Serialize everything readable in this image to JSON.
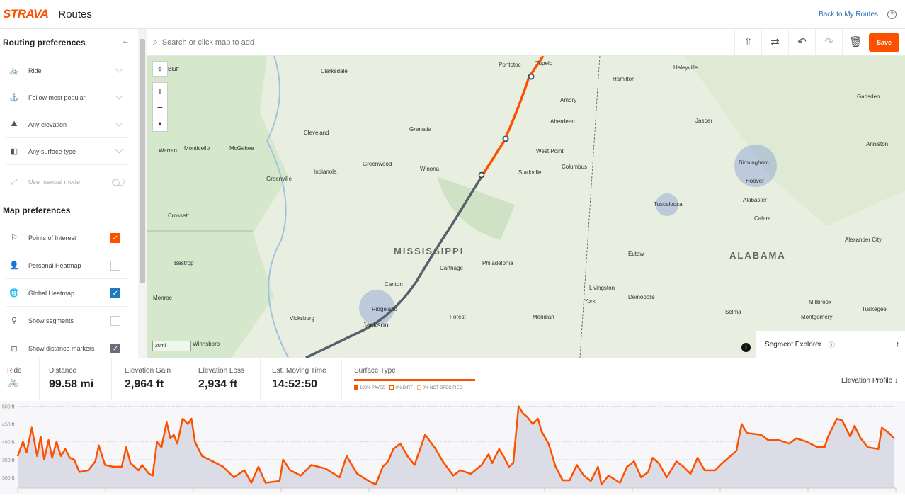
{
  "header": {
    "logo": "STRAVA",
    "title": "Routes",
    "back_link": "Back to My Routes",
    "help_icon": "help-circle-icon"
  },
  "colors": {
    "brand": "#fc5200",
    "heatmap_checked": "#1e7bbf",
    "distance_checked": "#6d6d78"
  },
  "sidebar": {
    "routing_title": "Routing preferences",
    "routing": [
      {
        "label": "Ride",
        "icon": "bike-icon"
      },
      {
        "label": "Follow most popular",
        "icon": "popularity-icon"
      },
      {
        "label": "Any elevation",
        "icon": "mountain-icon"
      },
      {
        "label": "Any surface type",
        "icon": "surface-icon"
      }
    ],
    "manual_mode": {
      "label": "Use manual mode",
      "enabled": false
    },
    "map_title": "Map preferences",
    "map": [
      {
        "label": "Points of Interest",
        "checked": true
      },
      {
        "label": "Personal Heatmap",
        "checked": false
      },
      {
        "label": "Global Heatmap",
        "checked": true
      },
      {
        "label": "Show segments",
        "checked": false
      },
      {
        "label": "Show distance markers",
        "checked": true
      }
    ]
  },
  "toolbar": {
    "search_placeholder": "Search or click map to add",
    "save": "Save"
  },
  "map": {
    "states": [
      "MISSISSIPPI",
      "ALABAMA"
    ],
    "cities": [
      "Bluff",
      "Clarksdale",
      "Pontotoc",
      "Tupelo",
      "Haleyville",
      "Hamilton",
      "Cleveland",
      "Grenada",
      "Amory",
      "Aberdeen",
      "Jasper",
      "Gadsden",
      "Warren",
      "Monticello",
      "McGehee",
      "Greenwood",
      "Winona",
      "West Point",
      "Columbus",
      "Starkville",
      "Indianola",
      "Greenville",
      "Birmingham",
      "Hoover",
      "Anniston",
      "Crossett",
      "Tuscaloosa",
      "Alabaster",
      "Calera",
      "Bastrop",
      "Carthage",
      "Philadelphia",
      "Eutaw",
      "Alexander City",
      "Canton",
      "Ridgeland",
      "Jackson",
      "Monroe",
      "Vicksburg",
      "Forest",
      "Meridian",
      "Livingston",
      "Demopolis",
      "York",
      "Selma",
      "Millbrook",
      "Montgomery",
      "Tuskegee",
      "Winnsboro"
    ],
    "scale": "20mi",
    "segment_explorer": "Segment Explorer"
  },
  "stats": {
    "activity": "Ride",
    "distance": {
      "label": "Distance",
      "value": "99.58 mi"
    },
    "gain": {
      "label": "Elevation Gain",
      "value": "2,964 ft"
    },
    "loss": {
      "label": "Elevation Loss",
      "value": "2,934 ft"
    },
    "time": {
      "label": "Est. Moving Time",
      "value": "14:52:50"
    },
    "surface": {
      "label": "Surface Type",
      "legend": [
        "100% PAVED",
        "0% DIRT",
        "0% NOT SPECIFIED"
      ]
    },
    "elevation_profile": "Elevation Profile ↓"
  },
  "chart_data": {
    "type": "area",
    "ylim": [
      270,
      515
    ],
    "yticks": [
      "300 ft",
      "350 ft",
      "400 ft",
      "450 ft",
      "500 ft"
    ],
    "ytick_values": [
      300,
      350,
      400,
      450,
      500
    ],
    "grid": true,
    "xlim": [
      0,
      99.58
    ],
    "x": [
      0,
      0.6,
      1.0,
      1.6,
      2.2,
      2.6,
      3.0,
      3.5,
      3.9,
      4.4,
      4.9,
      5.4,
      5.9,
      6.4,
      7.0,
      8.0,
      8.8,
      9.2,
      9.9,
      10.8,
      11.8,
      12.3,
      12.8,
      13.7,
      14.1,
      14.9,
      15.3,
      15.8,
      16.3,
      16.9,
      17.3,
      17.7,
      18.1,
      18.7,
      19.3,
      19.7,
      20.1,
      20.9,
      22.1,
      23.3,
      24.5,
      25.7,
      26.5,
      27.3,
      28.1,
      29.7,
      30.1,
      30.9,
      32.1,
      33.3,
      34.9,
      36.5,
      37.3,
      38.5,
      39.8,
      40.6,
      41.4,
      42.0,
      42.6,
      43.4,
      44.2,
      45.0,
      46.2,
      47.4,
      48.2,
      49.4,
      50.2,
      51.4,
      52.6,
      53.4,
      53.8,
      54.6,
      55.2,
      55.7,
      56.2,
      56.8,
      57.3,
      57.8,
      58.4,
      59.0,
      59.4,
      60.2,
      61.0,
      61.8,
      62.6,
      63.4,
      64.2,
      65.0,
      65.8,
      66.2,
      67.0,
      68.3,
      69.1,
      69.9,
      70.7,
      71.5,
      72.0,
      72.7,
      73.6,
      74.7,
      75.5,
      76.3,
      77.1,
      77.9,
      79.1,
      79.9,
      81.5,
      82.1,
      82.7,
      84.3,
      85.1,
      86.3,
      87.5,
      88.3,
      89.5,
      90.7,
      91.5,
      91.9,
      92.9,
      93.5,
      94.4,
      94.9,
      95.6,
      96.4,
      97.6,
      98.0,
      98.8,
      99.4
    ],
    "y": [
      360,
      400,
      370,
      440,
      360,
      415,
      350,
      405,
      355,
      400,
      360,
      380,
      355,
      350,
      315,
      320,
      345,
      390,
      335,
      330,
      330,
      385,
      340,
      320,
      335,
      310,
      305,
      400,
      385,
      455,
      410,
      420,
      395,
      465,
      450,
      465,
      400,
      360,
      345,
      330,
      300,
      320,
      285,
      330,
      285,
      290,
      350,
      320,
      305,
      335,
      325,
      300,
      360,
      310,
      290,
      280,
      330,
      345,
      380,
      395,
      360,
      335,
      420,
      380,
      345,
      305,
      320,
      310,
      335,
      365,
      340,
      380,
      355,
      330,
      340,
      500,
      480,
      470,
      450,
      465,
      430,
      395,
      330,
      292,
      292,
      335,
      305,
      290,
      330,
      280,
      305,
      285,
      330,
      345,
      300,
      315,
      355,
      340,
      300,
      345,
      330,
      310,
      355,
      320,
      320,
      340,
      375,
      450,
      425,
      420,
      405,
      405,
      395,
      410,
      400,
      385,
      385,
      415,
      465,
      460,
      415,
      445,
      410,
      385,
      380,
      440,
      425,
      410
    ]
  }
}
